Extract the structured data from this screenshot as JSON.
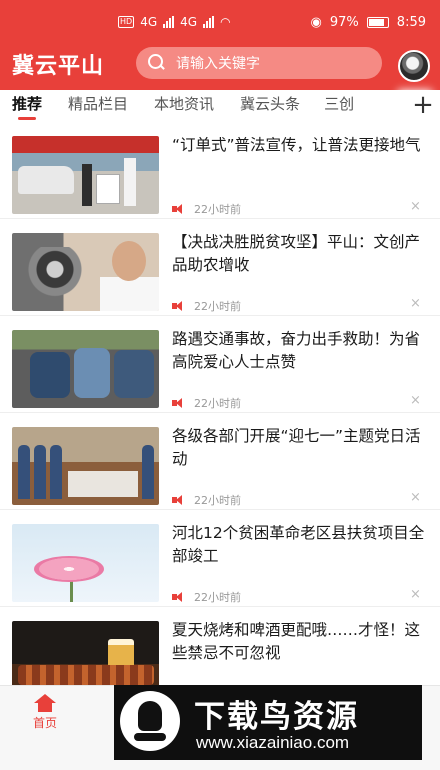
{
  "status_bar": {
    "hd": "HD",
    "network_1": "4G",
    "network_2": "4G",
    "battery": "97%",
    "time": "8:59"
  },
  "header": {
    "app_name": "冀云平山",
    "search_placeholder": "请输入关键字"
  },
  "tabs": [
    {
      "label": "推荐",
      "active": true
    },
    {
      "label": "精品栏目",
      "active": false
    },
    {
      "label": "本地资讯",
      "active": false
    },
    {
      "label": "冀云头条",
      "active": false
    },
    {
      "label": "三创",
      "active": false
    }
  ],
  "tab_add_symbol": "+",
  "feed": [
    {
      "title": "“订单式”普法宣传，让普法更接地气",
      "time": "22小时前"
    },
    {
      "title": "【决战决胜脱贫攻坚】平山：文创产品助农增收",
      "time": "22小时前"
    },
    {
      "title": "路遇交通事故，奋力出手救助！为省高院爱心人士点赞",
      "time": "22小时前"
    },
    {
      "title": "各级各部门开展“迎七一”主题党日活动",
      "time": "22小时前"
    },
    {
      "title": "河北12个贫困革命老区县扶贫项目全部竣工",
      "time": "22小时前"
    },
    {
      "title": "夏天烧烤和啤酒更配哦……才怪！这些禁忌不可忽视",
      "time": ""
    }
  ],
  "close_symbol": "×",
  "bottom_nav": {
    "home_label": "首页"
  },
  "watermark": {
    "title": "下载鸟资源",
    "url": "www.xiazainiao.com"
  },
  "colors": {
    "brand": "#e8403a",
    "search_bg": "#f58a84"
  }
}
